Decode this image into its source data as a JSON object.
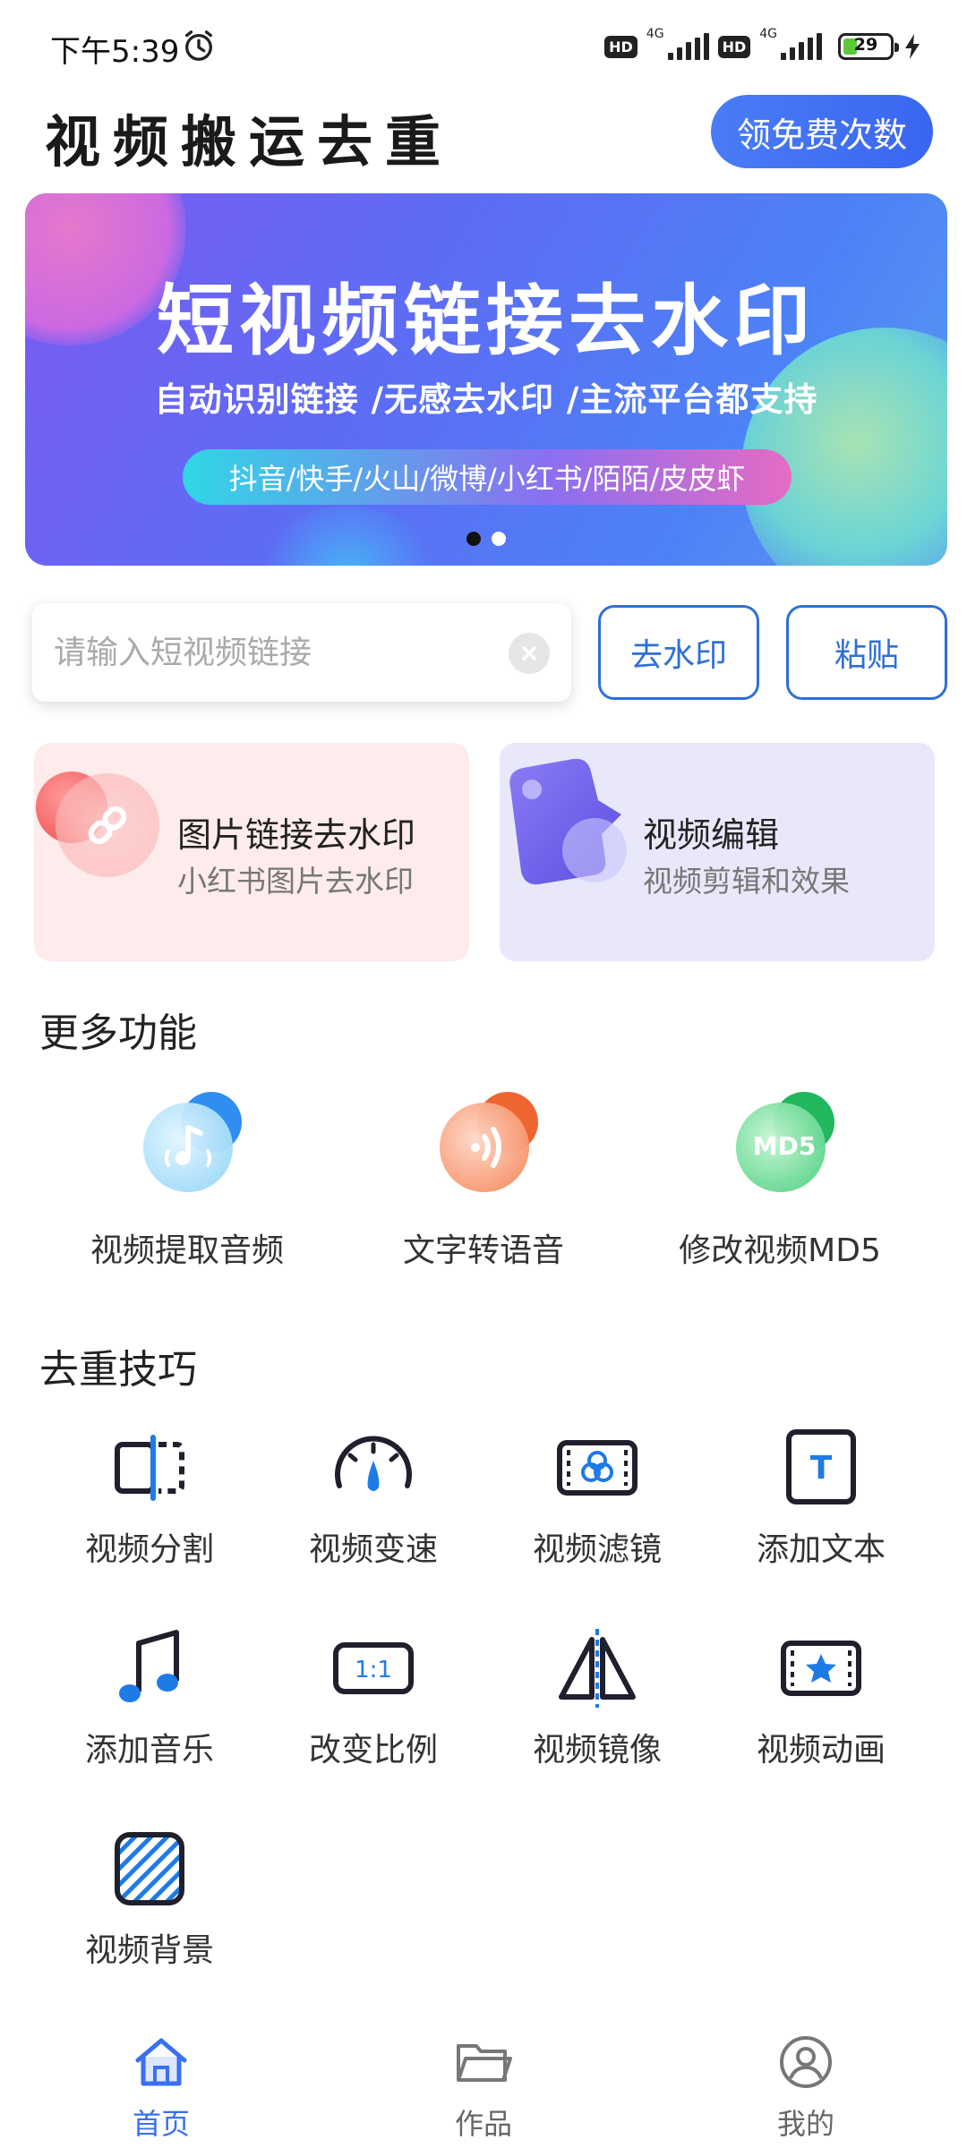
{
  "status_bar": {
    "time": "下午5:39",
    "hd1": "HD",
    "net1": "4G",
    "hd2": "HD",
    "net2": "4G",
    "battery": "29",
    "battery_level_percent": 29
  },
  "header": {
    "title": "视频搬运去重",
    "free_button": "领免费次数"
  },
  "banner": {
    "title": "短视频链接去水印",
    "subtitle": "自动识别链接 /无感去水印 /主流平台都支持",
    "platforms": "抖音/快手/火山/微博/小红书/陌陌/皮皮虾",
    "page_count": 2,
    "active_page": 1
  },
  "link_input": {
    "placeholder": "请输入短视频链接",
    "value": "",
    "remove_watermark_button": "去水印",
    "paste_button": "粘贴"
  },
  "feature_cards": [
    {
      "title": "图片链接去水印",
      "subtitle": "小红书图片去水印",
      "icon": "link-icon",
      "color": "#fdeceb"
    },
    {
      "title": "视频编辑",
      "subtitle": "视频剪辑和效果",
      "icon": "video-tag-icon",
      "color": "#e8e8fa"
    }
  ],
  "more_functions": {
    "title": "更多功能",
    "items": [
      {
        "label": "视频提取音频",
        "icon": "music-note-icon",
        "color": "#3aa0f0"
      },
      {
        "label": "文字转语音",
        "icon": "sound-wave-icon",
        "color": "#f06a34"
      },
      {
        "label": "修改视频MD5",
        "icon": "md5-icon",
        "color": "#2fc46a",
        "icon_text": "MD5"
      }
    ]
  },
  "tips": {
    "title": "去重技巧",
    "items": [
      {
        "label": "视频分割",
        "icon": "split-icon"
      },
      {
        "label": "视频变速",
        "icon": "speed-gauge-icon"
      },
      {
        "label": "视频滤镜",
        "icon": "filter-icon"
      },
      {
        "label": "添加文本",
        "icon": "text-icon",
        "icon_text": "T"
      },
      {
        "label": "添加音乐",
        "icon": "music-icon"
      },
      {
        "label": "改变比例",
        "icon": "ratio-icon",
        "icon_text": "1:1"
      },
      {
        "label": "视频镜像",
        "icon": "mirror-icon"
      },
      {
        "label": "视频动画",
        "icon": "star-film-icon"
      },
      {
        "label": "视频背景",
        "icon": "background-icon"
      }
    ]
  },
  "bottom_nav": {
    "items": [
      {
        "label": "首页",
        "icon": "home-icon",
        "active": true
      },
      {
        "label": "作品",
        "icon": "folder-icon",
        "active": false
      },
      {
        "label": "我的",
        "icon": "user-icon",
        "active": false
      }
    ]
  },
  "colors": {
    "accent": "#3a6ff0",
    "dark_icon": "#1f1f2e",
    "icon_blue": "#1e7be6"
  }
}
